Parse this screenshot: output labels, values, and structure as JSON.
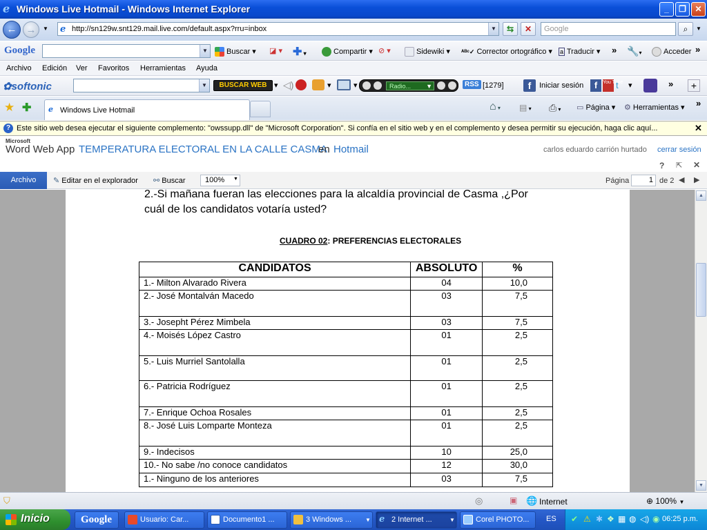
{
  "window": {
    "title": "Windows Live Hotmail - Windows Internet Explorer"
  },
  "address": {
    "url": "http://sn129w.snt129.mail.live.com/default.aspx?rru=inbox",
    "search_placeholder": "Google"
  },
  "google_toolbar": {
    "logo": "Google",
    "buscar": "Buscar",
    "compartir": "Compartir",
    "sidewiki": "Sidewiki",
    "corrector": "Corrector ortográfico",
    "traducir": "Traducir",
    "acceder": "Acceder"
  },
  "menu": {
    "items": [
      "Archivo",
      "Edición",
      "Ver",
      "Favoritos",
      "Herramientas",
      "Ayuda"
    ]
  },
  "softonic": {
    "logo": "softonic",
    "buscar_web": "BUSCAR WEB",
    "radio": "Radio...",
    "rss_count": "[1279]",
    "iniciar_sesion": "Iniciar sesión"
  },
  "tabs": {
    "active": "Windows Live Hotmail",
    "pagina": "Página",
    "herramientas": "Herramientas"
  },
  "infobar": {
    "text": "Este sitio web desea ejecutar el siguiente complemento: \"owssupp.dll\" de \"Microsoft Corporation\". Si confía en el sitio web y en el complemento y desea permitir su ejecución, haga clic aquí..."
  },
  "wwa": {
    "microsoft": "Microsoft",
    "app": "Word Web App",
    "doc_title": "TEMPERATURA ELECTORAL EN LA CALLE CASMA",
    "en": "en",
    "hotmail": "Hotmail",
    "user": "carlos eduardo carrión hurtado",
    "signout": "cerrar sesión"
  },
  "ribbon": {
    "archivo": "Archivo",
    "editar": "Editar en el explorador",
    "buscar": "Buscar",
    "zoom": "100%",
    "pagina_label": "Página",
    "pagina_num": "1",
    "de": "de 2"
  },
  "document": {
    "question_line1": "2.-Si mañana fueran las elecciones para la alcaldía provincial de Casma ,¿Por",
    "question_line2": "cuál de los candidatos votaría usted?",
    "cuadro_label": "CUADRO 02",
    "cuadro_rest": ": PREFERENCIAS ELECTORALES",
    "table": {
      "headers": [
        "CANDIDATOS",
        "ABSOLUTO",
        "%"
      ],
      "rows": [
        [
          "1.- Milton Alvarado Rivera",
          "04",
          "10,0"
        ],
        [
          "2.- José Montalván Macedo",
          "03",
          "7,5"
        ],
        [
          "3.- Josepht Pérez Mimbela",
          "03",
          "7,5"
        ],
        [
          "4.- Moisés López Castro",
          "01",
          "2,5"
        ],
        [
          "5.- Luis Murriel Santolalla",
          "01",
          "2,5"
        ],
        [
          "6.- Patricia Rodríguez",
          "01",
          "2,5"
        ],
        [
          "7.- Enrique Ochoa Rosales",
          "01",
          "2,5"
        ],
        [
          "8.- José Luis Lomparte Monteza",
          "01",
          "2,5"
        ],
        [
          "9.- Indecisos",
          "10",
          "25,0"
        ],
        [
          "10.- No sabe /no conoce candidatos",
          "12",
          "30,0"
        ],
        [
          "1.- Ninguno de los anteriores",
          "03",
          "7,5"
        ]
      ]
    }
  },
  "status": {
    "zone": "Internet",
    "zoom": "100%"
  },
  "taskbar": {
    "start": "Inicio",
    "google": "Google",
    "tasks": [
      "Usuario: Car...",
      "Documento1 ...",
      "3 Windows ...",
      "2 Internet ...",
      "Corel PHOTO..."
    ],
    "lang": "ES",
    "clock": "06:25 p.m."
  }
}
